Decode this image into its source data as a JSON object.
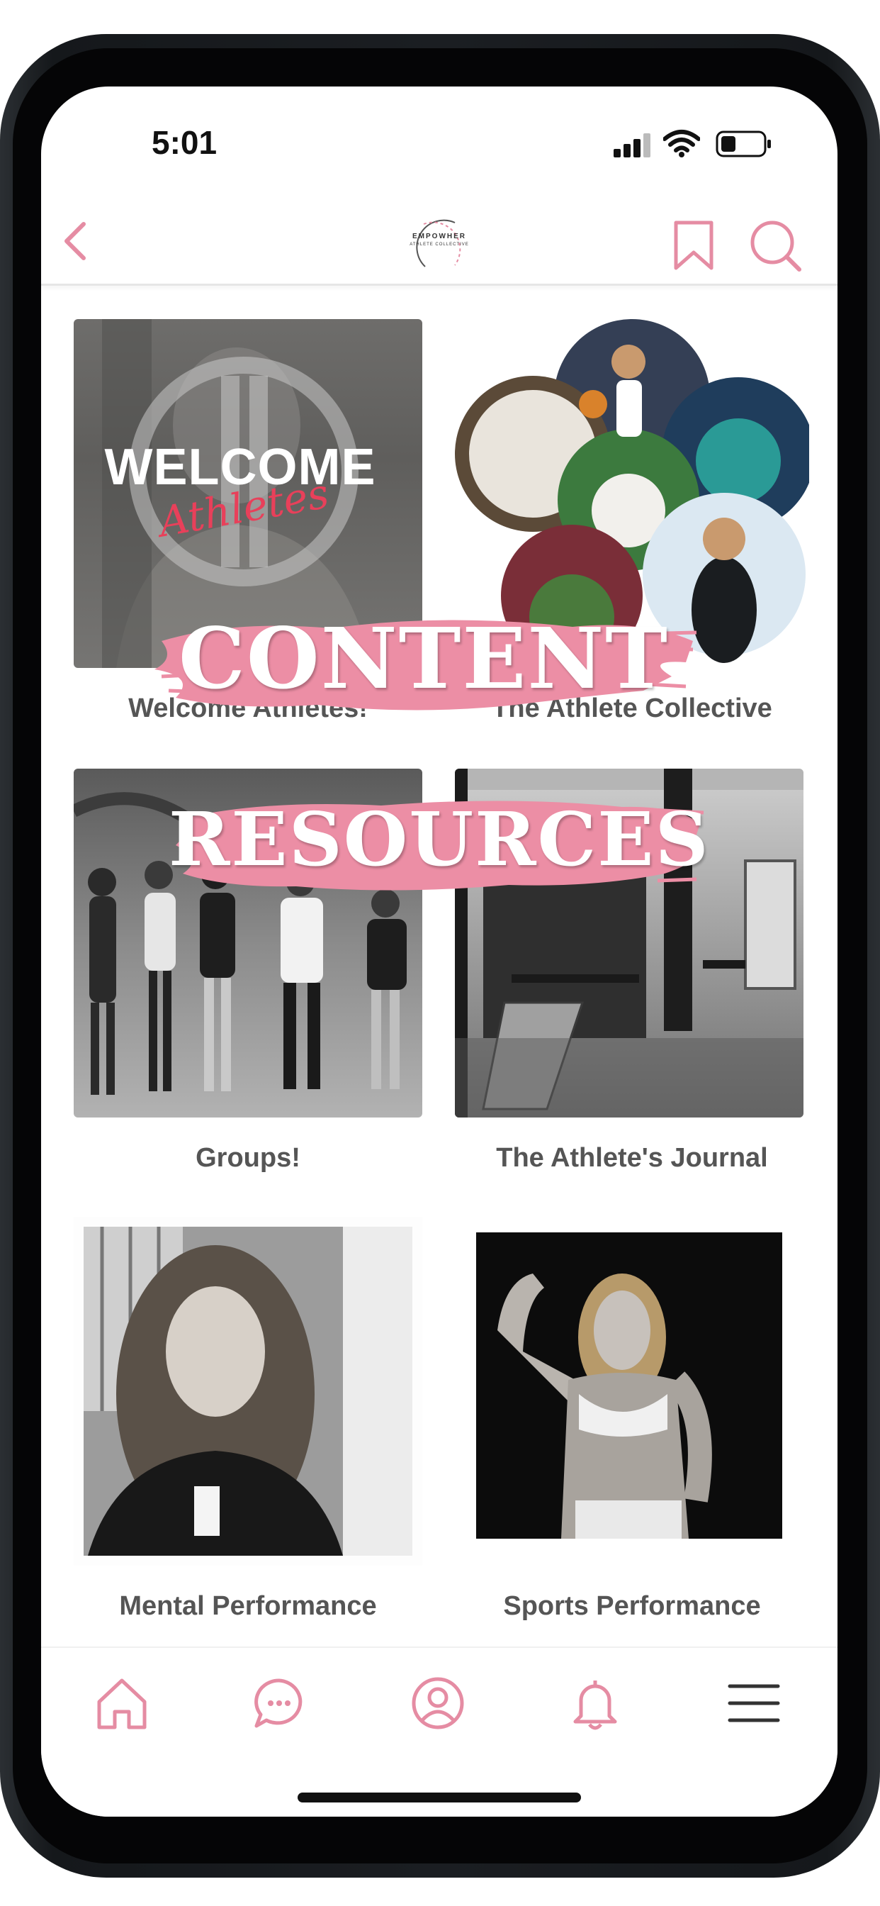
{
  "status": {
    "time": "5:01"
  },
  "nav": {
    "logo_line1": "EMPOWHER",
    "logo_line2": "ATHLETE COLLECTIVE"
  },
  "welcome_tile": {
    "title_big": "WELCOME",
    "title_script": "Athletes"
  },
  "cards": [
    {
      "label": "Welcome Athletes!"
    },
    {
      "label": "The Athlete Collective"
    },
    {
      "label": "Groups!"
    },
    {
      "label": "The Athlete's Journal"
    },
    {
      "label": "Mental Performance"
    },
    {
      "label": "Sports Performance"
    }
  ],
  "banners": {
    "top": "CONTENT",
    "bottom": "RESOURCES"
  },
  "colors": {
    "accent": "#e58ca3",
    "banner": "#ec8ea5",
    "caption": "#555555"
  },
  "tabs": [
    "home-icon",
    "chat-icon",
    "profile-icon",
    "bell-icon",
    "menu-icon"
  ]
}
